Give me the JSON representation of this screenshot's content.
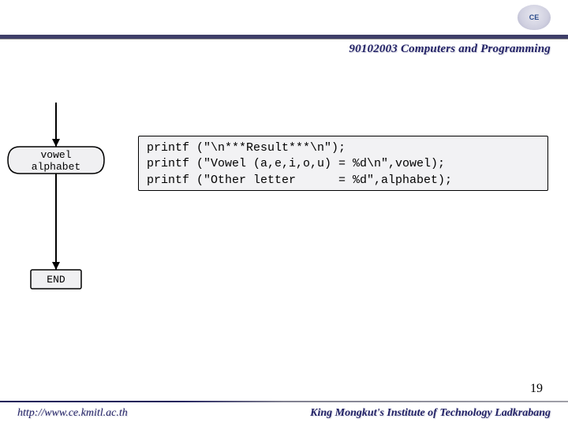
{
  "logo_text": "CE",
  "course_title": "90102003 Computers and Programming",
  "flowchart": {
    "box1_line1": "vowel",
    "box1_line2": "alphabet",
    "end_label": "END"
  },
  "code": {
    "line1": "printf (\"\\n***Result***\\n\");",
    "line2": "printf (\"Vowel (a,e,i,o,u) = %d\\n\",vowel);",
    "line3": "printf (\"Other letter      = %d\",alphabet);"
  },
  "page_number": "19",
  "footer": {
    "url": "http://www.ce.kmitl.ac.th",
    "institute": "King Mongkut's Institute of Technology Ladkrabang"
  }
}
